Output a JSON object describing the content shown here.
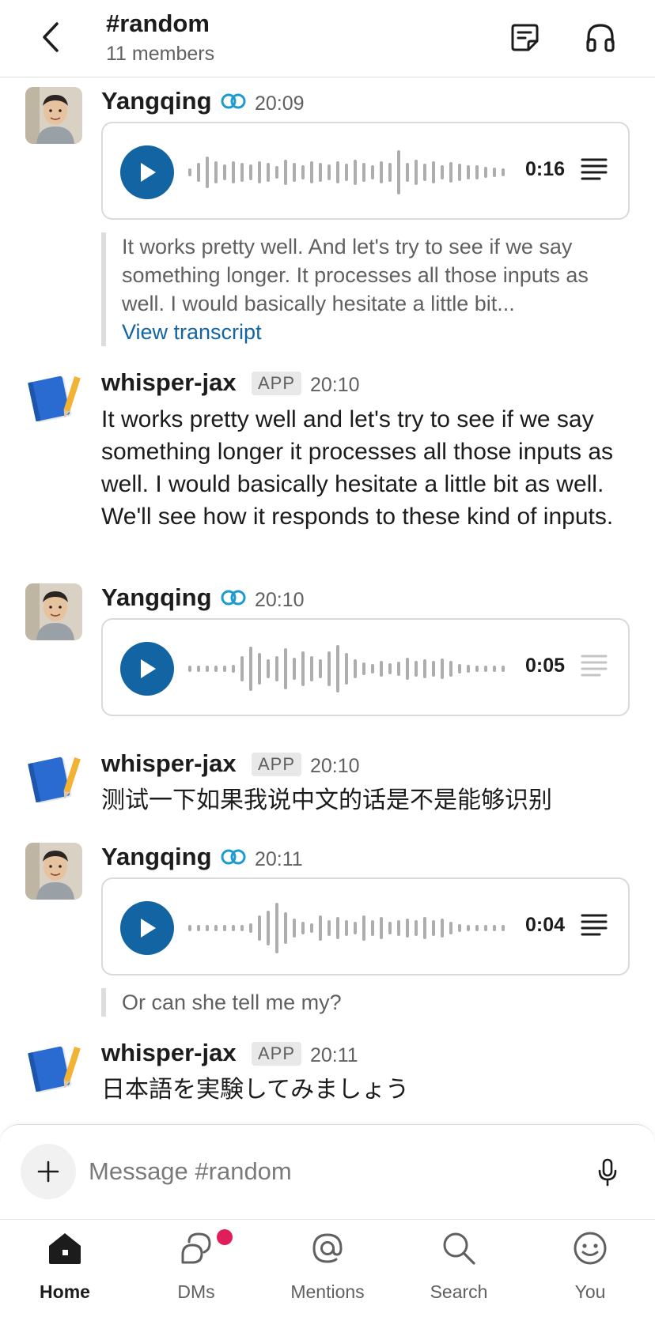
{
  "header": {
    "channel_name": "#random",
    "members": "11 members"
  },
  "messages": [
    {
      "type": "audio",
      "user": "Yangqing",
      "time": "20:09",
      "duration": "0:16",
      "transcript_preview": "It works pretty well. And let's try to see if we say something longer. It processes all those inputs as well. I would basically hesitate a little bit...",
      "transcript_link": "View transcript"
    },
    {
      "type": "text",
      "user": "whisper-jax",
      "badge": "APP",
      "time": "20:10",
      "text": "It works pretty well and let's try to see if we say something longer it processes all those inputs as well. I would basically hesitate a little bit as well. We'll see how it responds to these kind of inputs."
    },
    {
      "type": "audio",
      "user": "Yangqing",
      "time": "20:10",
      "duration": "0:05"
    },
    {
      "type": "text",
      "user": "whisper-jax",
      "badge": "APP",
      "time": "20:10",
      "text": "测试一下如果我说中文的话是不是能够识别"
    },
    {
      "type": "audio",
      "user": "Yangqing",
      "time": "20:11",
      "duration": "0:04",
      "transcript_preview": "Or can she tell me my?"
    },
    {
      "type": "text",
      "user": "whisper-jax",
      "badge": "APP",
      "time": "20:11",
      "text": "日本語を実験してみましょう"
    }
  ],
  "composer": {
    "placeholder": "Message #random"
  },
  "nav": {
    "items": [
      {
        "label": "Home",
        "icon": "home-icon",
        "active": true
      },
      {
        "label": "DMs",
        "icon": "dms-icon"
      },
      {
        "label": "Mentions",
        "icon": "mentions-icon"
      },
      {
        "label": "Search",
        "icon": "search-icon"
      },
      {
        "label": "You",
        "icon": "you-icon"
      }
    ]
  },
  "colors": {
    "accent": "#1264a3",
    "notification": "#e01e5a",
    "text": "#1d1c1d",
    "muted": "#616061"
  }
}
